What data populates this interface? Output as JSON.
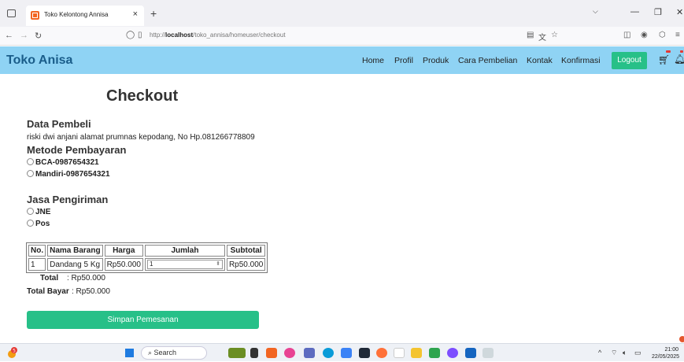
{
  "browser": {
    "tab_title": "Toko Kelontong Annisa",
    "tab_close": "×",
    "new_tab": "+",
    "url_prefix": "http://",
    "url_host": "localhost",
    "url_path": "/toko_annisa/homeuser/checkout"
  },
  "site": {
    "brand": "Toko Anisa",
    "menu": [
      "Home",
      "Profil",
      "Produk",
      "Cara Pembelian",
      "Kontak",
      "Konfirmasi"
    ],
    "logout": "Logout"
  },
  "checkout": {
    "title": "Checkout",
    "buyer_heading": "Data Pembeli",
    "buyer_info": "riski dwi anjani alamat prumnas kepodang, No Hp.081266778809",
    "payment_heading": "Metode Pembayaran",
    "payment_options": [
      "BCA-0987654321",
      "Mandiri-0987654321"
    ],
    "shipping_heading": "Jasa Pengiriman",
    "shipping_options": [
      "JNE",
      "Pos"
    ],
    "table": {
      "headers": [
        "No.",
        "Nama Barang",
        "Harga",
        "Jumlah",
        "Subtotal"
      ],
      "rows": [
        {
          "no": "1",
          "name": "Dandang 5 Kg",
          "price": "Rp50.000",
          "qty": "1",
          "subtotal": "Rp50.000"
        }
      ]
    },
    "total_label": "Total",
    "total_value": ": Rp50.000",
    "total_bayar_label": "Total Bayar",
    "total_bayar_value": ": Rp50.000",
    "submit": "Simpan Pemesanan"
  },
  "taskbar": {
    "search": "Search",
    "time": "21:00",
    "date": "22/05/2025",
    "notification_count": "5"
  }
}
